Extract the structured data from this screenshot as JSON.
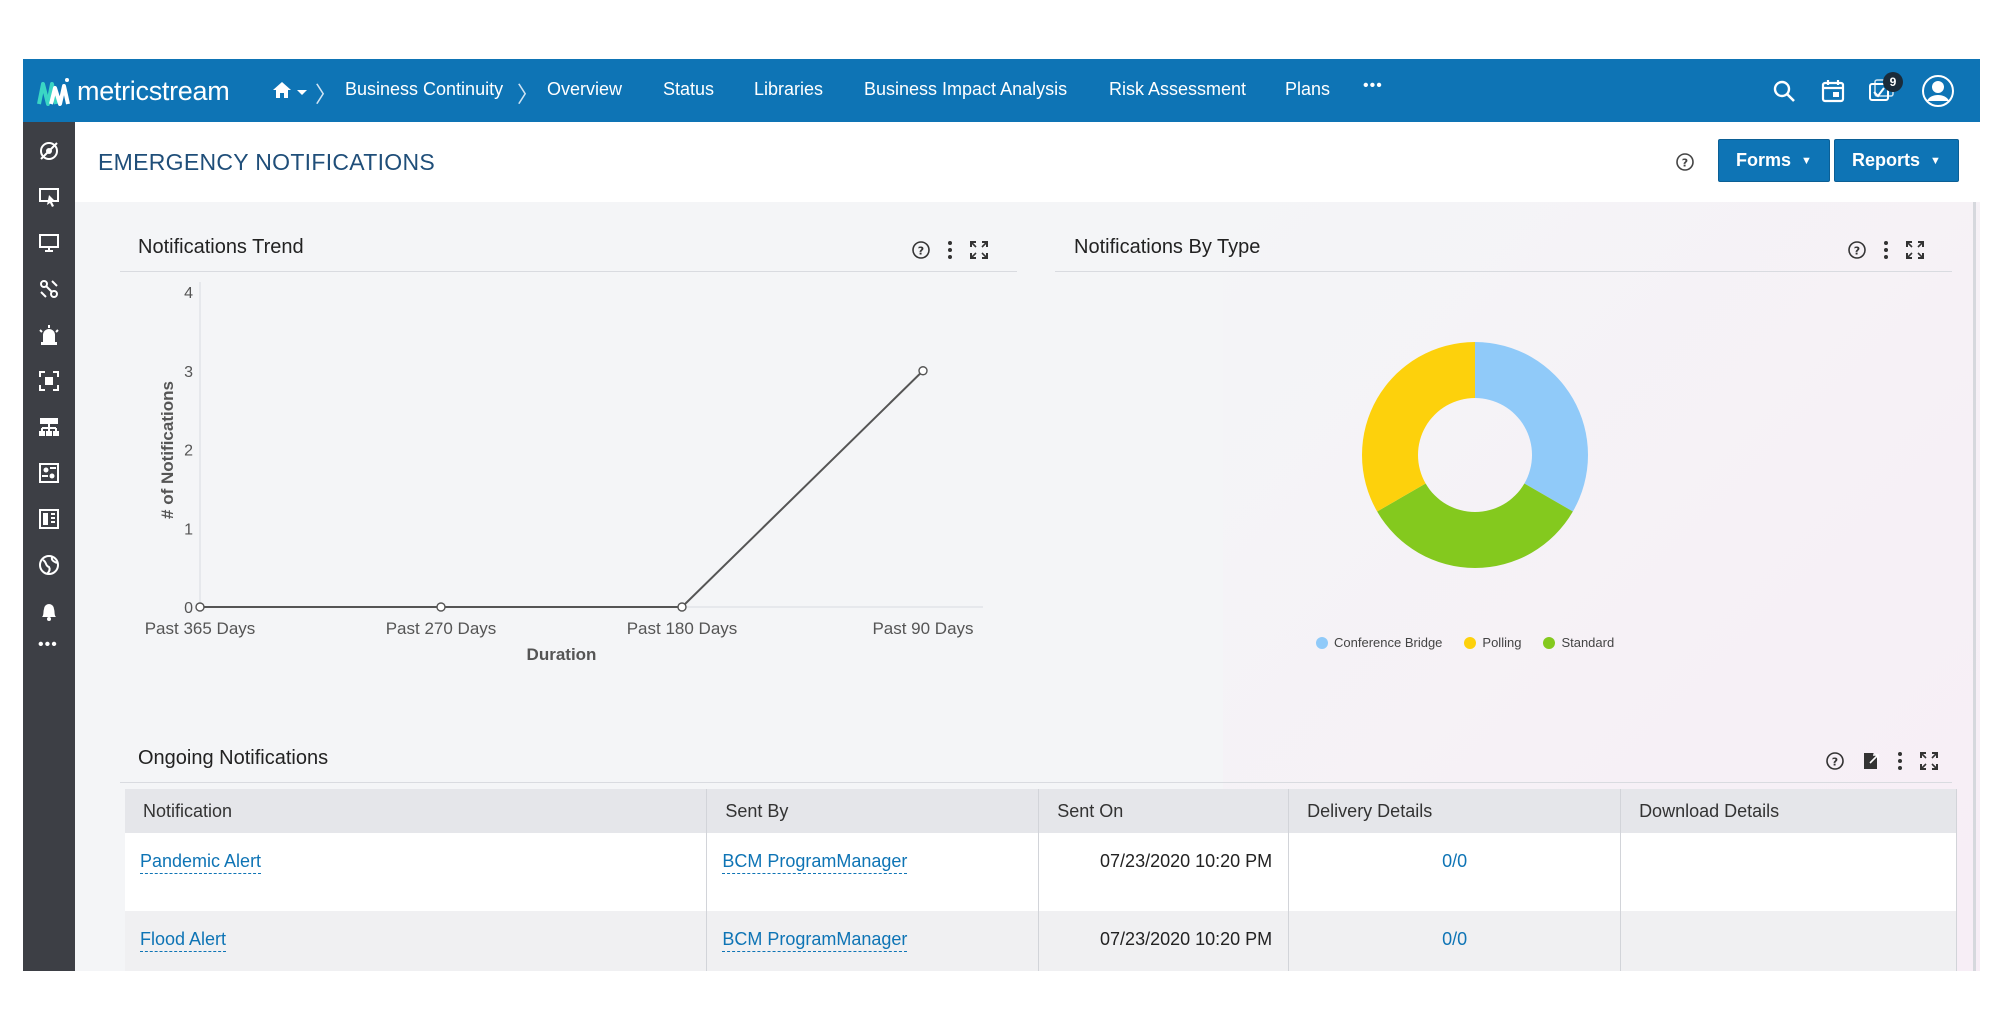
{
  "app": {
    "brand": "metricstream"
  },
  "nav": {
    "items": [
      "Business Continuity",
      "Overview",
      "Status",
      "Libraries",
      "Business Impact Analysis",
      "Risk Assessment",
      "Plans"
    ],
    "more": "•••",
    "badge_count": "9"
  },
  "header": {
    "title": "EMERGENCY NOTIFICATIONS",
    "forms_label": "Forms",
    "reports_label": "Reports"
  },
  "trend": {
    "title": "Notifications Trend"
  },
  "bytype": {
    "title": "Notifications By Type",
    "legend": [
      {
        "label": "Conference Bridge",
        "color": "#90caf9"
      },
      {
        "label": "Polling",
        "color": "#fdd10c"
      },
      {
        "label": "Standard",
        "color": "#84c91e"
      }
    ]
  },
  "chart_data": [
    {
      "type": "line",
      "title": "Notifications Trend",
      "categories": [
        "Past 365 Days",
        "Past 270 Days",
        "Past 180 Days",
        "Past 90 Days"
      ],
      "values": [
        0,
        0,
        0,
        3
      ],
      "xlabel": "Duration",
      "ylabel": "# of Notifications",
      "ylim": [
        0,
        4
      ],
      "yticks": [
        "0",
        "1",
        "2",
        "3",
        "4"
      ],
      "color": "#555555",
      "grid": false
    },
    {
      "type": "pie",
      "title": "Notifications By Type",
      "donut": true,
      "labels": [
        "Conference Bridge",
        "Standard",
        "Polling"
      ],
      "values": [
        1,
        1,
        1
      ],
      "colors": [
        "#90caf9",
        "#84c91e",
        "#fdd10c"
      ],
      "legend": "bottom"
    }
  ],
  "ongoing": {
    "title": "Ongoing Notifications",
    "columns": [
      "Notification",
      "Sent By",
      "Sent On",
      "Delivery Details",
      "Download Details"
    ],
    "rows": [
      {
        "notification": "Pandemic Alert",
        "sent_by": "BCM ProgramManager",
        "sent_on": "07/23/2020 10:20 PM",
        "delivery": "0/0",
        "download": ""
      },
      {
        "notification": "Flood Alert",
        "sent_by": "BCM ProgramManager",
        "sent_on": "07/23/2020 10:20 PM",
        "delivery": "0/0",
        "download": ""
      }
    ]
  }
}
